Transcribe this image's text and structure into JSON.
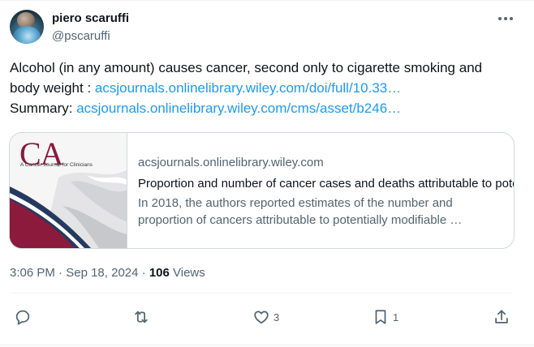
{
  "author": {
    "display_name": "piero scaruffi",
    "handle": "@pscaruffi"
  },
  "tweet": {
    "line1": "Alcohol (in any amount) causes cancer, second only to cigarette smoking and body weight : ",
    "link1": "acsjournals.onlinelibrary.wiley.com/doi/full/10.33…",
    "summary_label": "Summary: ",
    "link2": "acsjournals.onlinelibrary.wiley.com/cms/asset/b246…"
  },
  "card": {
    "logo_text": "CA",
    "logo_subtitle": "A Cancer Journal for Clinicians",
    "domain": "acsjournals.onlinelibrary.wiley.com",
    "title": "Proportion and number of cancer cases and deaths attributable to potentially modifiable risk factors",
    "description": "In 2018, the authors reported estimates of the number and proportion of cancers attributable to potentially modifiable …"
  },
  "meta": {
    "time": "3:06 PM",
    "separator1": " · ",
    "date": "Sep 18, 2024",
    "separator2": " · ",
    "views_count": "106",
    "views_label": " Views"
  },
  "actions": {
    "reply_count": "",
    "retweet_count": "",
    "like_count": "3",
    "bookmark_count": "1",
    "reply_icon": "reply-icon",
    "retweet_icon": "retweet-icon",
    "like_icon": "heart-icon",
    "bookmark_icon": "bookmark-icon",
    "share_icon": "share-icon"
  },
  "colors": {
    "link": "#1d9bf0",
    "secondary_text": "#536471",
    "primary_text": "#0f1419",
    "card_brand": "#8b1a3c"
  }
}
